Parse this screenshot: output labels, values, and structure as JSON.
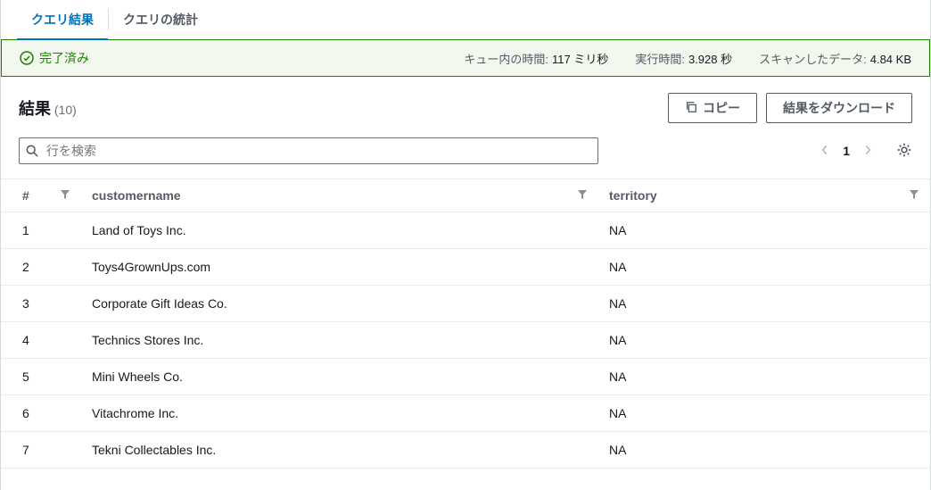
{
  "tabs": {
    "results": "クエリ結果",
    "stats": "クエリの統計"
  },
  "status": {
    "label": "完了済み",
    "queue_time_label": "キュー内の時間:",
    "queue_time_value": "117 ミリ秒",
    "run_time_label": "実行時間:",
    "run_time_value": "3.928 秒",
    "scanned_label": "スキャンしたデータ:",
    "scanned_value": "4.84 KB"
  },
  "results": {
    "title": "結果",
    "count": "(10)",
    "copy": "コピー",
    "download": "結果をダウンロード"
  },
  "search": {
    "placeholder": "行を検索"
  },
  "pagination": {
    "page": "1"
  },
  "columns": {
    "idx": "#",
    "customername": "customername",
    "territory": "territory"
  },
  "rows": [
    {
      "idx": "1",
      "customername": "Land of Toys Inc.",
      "territory": "NA"
    },
    {
      "idx": "2",
      "customername": "Toys4GrownUps.com",
      "territory": "NA"
    },
    {
      "idx": "3",
      "customername": "Corporate Gift Ideas Co.",
      "territory": "NA"
    },
    {
      "idx": "4",
      "customername": "Technics Stores Inc.",
      "territory": "NA"
    },
    {
      "idx": "5",
      "customername": "Mini Wheels Co.",
      "territory": "NA"
    },
    {
      "idx": "6",
      "customername": "Vitachrome Inc.",
      "territory": "NA"
    },
    {
      "idx": "7",
      "customername": "Tekni Collectables Inc.",
      "territory": "NA"
    }
  ]
}
